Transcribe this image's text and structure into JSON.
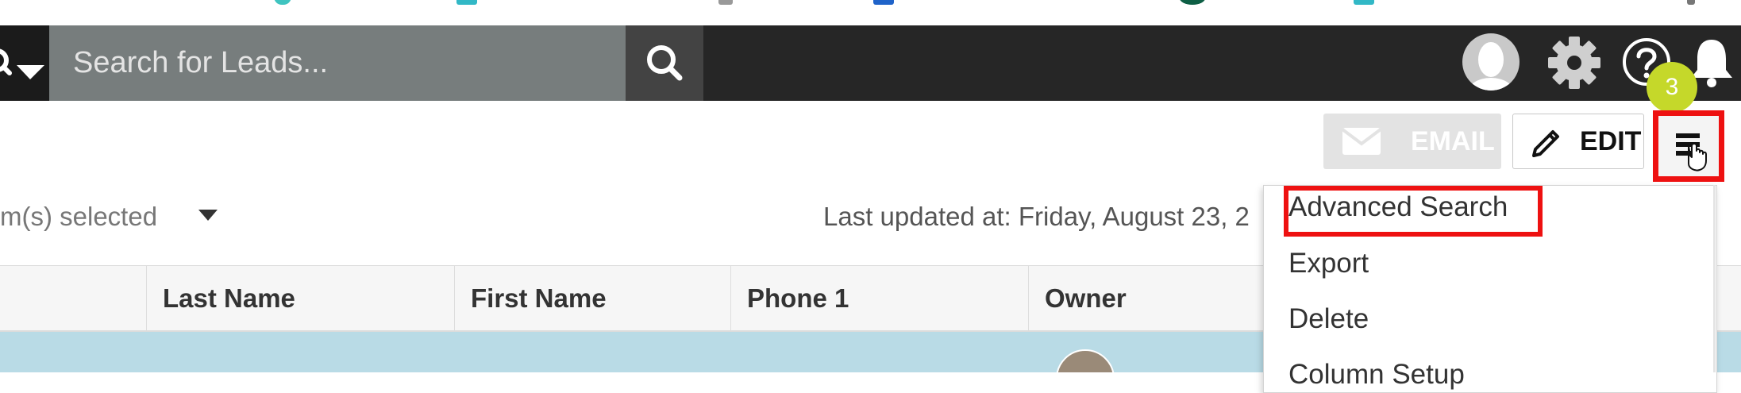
{
  "header": {
    "search_placeholder": "Search for Leads...",
    "notification_count": "3"
  },
  "toolbar": {
    "email_label": "EMAIL",
    "edit_label": "EDIT"
  },
  "filter": {
    "items_selected_text": "m(s) selected",
    "last_updated_text": "Last updated at: Friday, August 23, 2"
  },
  "table": {
    "columns": [
      "Last Name",
      "First Name",
      "Phone 1",
      "Owner"
    ]
  },
  "menu": {
    "items": [
      "Advanced Search",
      "Export",
      "Delete",
      "Column Setup"
    ]
  },
  "colors": {
    "topbar": "#262626",
    "search_field": "#777d7d",
    "badge": "#c5d82a",
    "highlight": "#ee1111",
    "row_selected": "#b9dbe6"
  }
}
